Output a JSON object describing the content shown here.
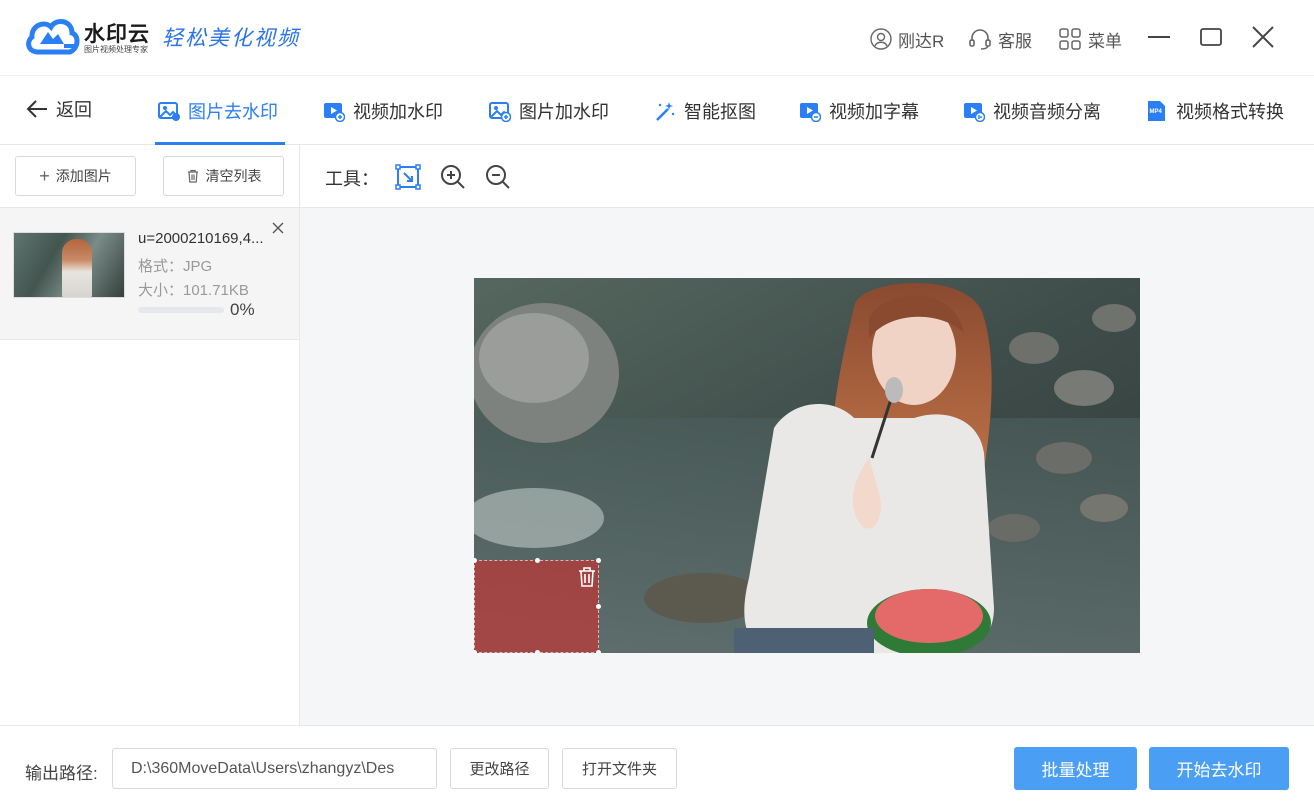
{
  "app": {
    "brand": "水印云",
    "brand_sub": "图片视频处理专家",
    "slogan": "轻松美化视频"
  },
  "titlebar": {
    "user": "刚达R",
    "service": "客服",
    "menu": "菜单"
  },
  "nav": {
    "back": "返回",
    "tabs": [
      {
        "label": "图片去水印",
        "active": true
      },
      {
        "label": "视频加水印"
      },
      {
        "label": "图片加水印"
      },
      {
        "label": "智能抠图"
      },
      {
        "label": "视频加字幕"
      },
      {
        "label": "视频音频分离"
      },
      {
        "label": "视频格式转换"
      }
    ]
  },
  "left": {
    "add_button": "添加图片",
    "clear_button": "清空列表",
    "file": {
      "name": "u=2000210169,4...",
      "format": "格式：JPG",
      "size": "大小：101.71KB",
      "progress_percent": 0,
      "progress_label": "0%"
    }
  },
  "toolbar": {
    "label": "工具："
  },
  "footer": {
    "output_label": "输出路径:",
    "output_path": "D:\\360MoveData\\Users\\zhangyz\\Des",
    "change_path": "更改路径",
    "open_folder": "打开文件夹",
    "batch": "批量处理",
    "start": "开始去水印"
  },
  "colors": {
    "accent": "#2a7ff5",
    "primary_button": "#4a9ff5",
    "watermark_box": "#dc2828"
  }
}
